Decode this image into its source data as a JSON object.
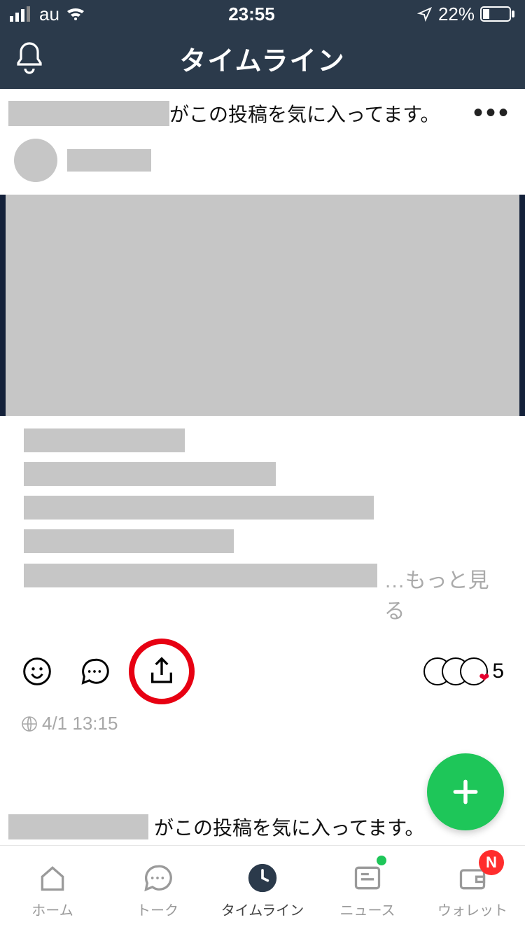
{
  "status": {
    "carrier": "au",
    "time": "23:55",
    "battery_pct": "22%"
  },
  "header": {
    "title": "タイムライン"
  },
  "feed": {
    "posts": [
      {
        "liked_suffix": "がこの投稿を気に入ってます。",
        "more_text": "…もっと見る",
        "reactions_count": "5",
        "timestamp": "4/1 13:15"
      },
      {
        "liked_suffix": "がこの投稿を気に入ってます。"
      }
    ]
  },
  "tabs": {
    "home": "ホーム",
    "talk": "トーク",
    "timeline": "タイムライン",
    "news": "ニュース",
    "wallet": "ウォレット",
    "wallet_badge": "N"
  }
}
